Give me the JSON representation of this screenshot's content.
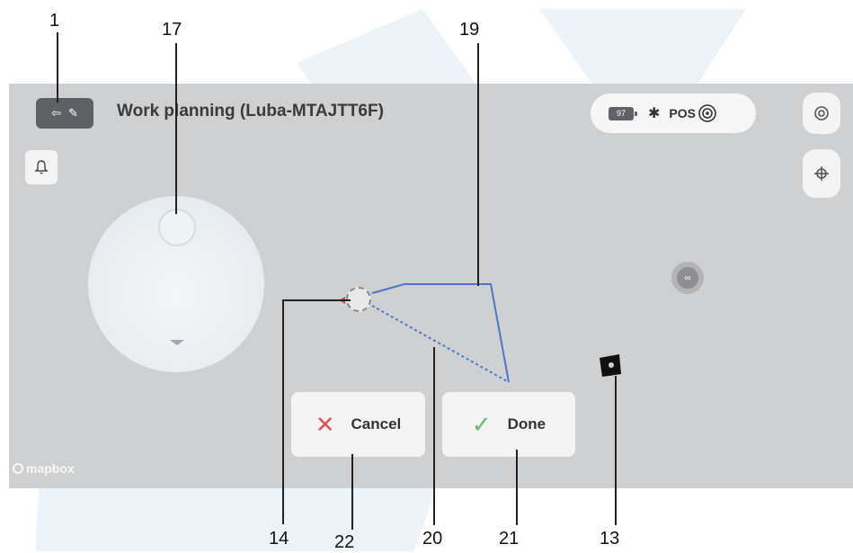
{
  "callouts": {
    "n1": "1",
    "n17": "17",
    "n19": "19",
    "n14": "14",
    "n22": "22",
    "n20": "20",
    "n21": "21",
    "n13": "13"
  },
  "header": {
    "title": "Work planning (Luba-MTAJTT6F)",
    "battery_level": "97",
    "pos_label": "POS"
  },
  "icons": {
    "back_edit": "exit-edit-icon",
    "bell": "bell-icon",
    "settings": "settings-icon",
    "locate": "locate-icon",
    "bluetooth": "bluetooth-icon",
    "pos_signal": "pos-signal-icon",
    "robot": "robot-marker-icon",
    "charging_station": "charging-station-icon"
  },
  "buttons": {
    "cancel_label": "Cancel",
    "done_label": "Done"
  },
  "map": {
    "attribution": "mapbox"
  },
  "colors": {
    "screen_bg": "#cfd0d1",
    "path_blue": "#4a78c9",
    "cancel_red": "#e05252",
    "done_green": "#5fbf6a",
    "watermark": "#d9ecf7"
  }
}
